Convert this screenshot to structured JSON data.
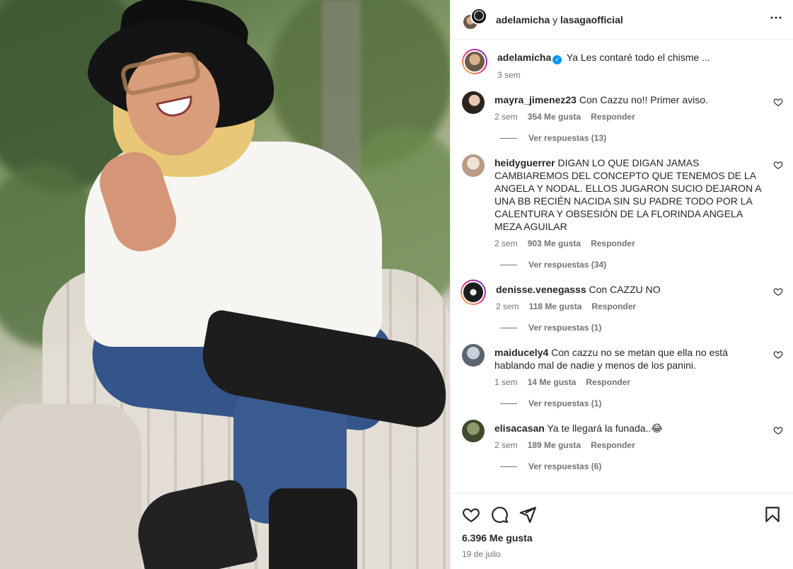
{
  "header": {
    "user1": "adelamicha",
    "separator": " y ",
    "user2": "lasagaofficial",
    "more_icon": "more-horizontal-icon"
  },
  "caption": {
    "username": "adelamicha",
    "verified_icon": "verified-badge-icon",
    "text": "Ya Les contaré todo el chisme ...",
    "time": "3 sem"
  },
  "comments": [
    {
      "username": "mayra_jimenez23",
      "text": "Con Cazzu no!! Primer aviso.",
      "time": "2 sem",
      "likes": "354 Me gusta",
      "reply": "Responder",
      "view_replies": "Ver respuestas (13)"
    },
    {
      "username": "heidyguerrer",
      "text": "DIGAN LO QUE DIGAN JAMAS CAMBIAREMOS DEL CONCEPTO QUE TENEMOS DE LA ANGELA Y NODAL. ELLOS JUGARON SUCIO DEJARON A UNA BB RECIÉN NACIDA SIN SU PADRE TODO POR LA CALENTURA Y OBSESIÓN DE LA FLORINDA ANGELA MEZA AGUILAR",
      "time": "2 sem",
      "likes": "903 Me gusta",
      "reply": "Responder",
      "view_replies": "Ver respuestas (34)"
    },
    {
      "username": "denisse.venegasss",
      "text": "Con CAZZU NO",
      "time": "2 sem",
      "likes": "118 Me gusta",
      "reply": "Responder",
      "view_replies": "Ver respuestas (1)"
    },
    {
      "username": "maiducely4",
      "text": "Con cazzu no se metan que ella no está hablando mal de nadie y menos de los panini.",
      "time": "1 sem",
      "likes": "14 Me gusta",
      "reply": "Responder",
      "view_replies": "Ver respuestas (1)"
    },
    {
      "username": "elisacasan",
      "text": "Ya te llegará la funada..😂",
      "time": "2 sem",
      "likes": "189 Me gusta",
      "reply": "Responder",
      "view_replies": "Ver respuestas (6)"
    }
  ],
  "actions": {
    "like_icon": "heart-icon",
    "comment_icon": "comment-icon",
    "share_icon": "share-icon",
    "save_icon": "bookmark-icon",
    "likes": "6.396 Me gusta",
    "date": "19 de julio"
  }
}
